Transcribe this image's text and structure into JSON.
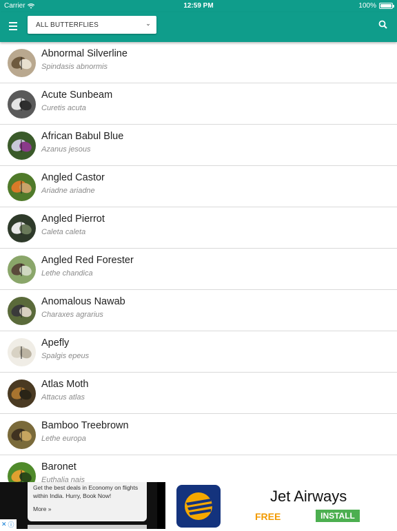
{
  "status_bar": {
    "carrier": "Carrier",
    "time": "12:59 PM",
    "battery": "100%",
    "battery_level": 1.0
  },
  "toolbar": {
    "menu_icon": "hamburger-menu-icon",
    "filter_value": "ALL BUTTERFLIES",
    "filter_icon": "chevron-down-icon",
    "search_icon": "search-icon",
    "color": "#0f9d8b"
  },
  "butterflies": [
    {
      "name": "Abnormal Silverline",
      "scientific": "Spindasis abnormis"
    },
    {
      "name": "Acute Sunbeam",
      "scientific": "Curetis acuta"
    },
    {
      "name": "African Babul Blue",
      "scientific": "Azanus jesous"
    },
    {
      "name": "Angled Castor",
      "scientific": "Ariadne ariadne"
    },
    {
      "name": "Angled Pierrot",
      "scientific": "Caleta caleta"
    },
    {
      "name": "Angled Red Forester",
      "scientific": "Lethe chandica"
    },
    {
      "name": "Anomalous Nawab",
      "scientific": "Charaxes agrarius"
    },
    {
      "name": "Apefly",
      "scientific": "Spalgis epeus"
    },
    {
      "name": "Atlas Moth",
      "scientific": "Attacus atlas"
    },
    {
      "name": "Bamboo Treebrown",
      "scientific": "Lethe europa"
    },
    {
      "name": "Baronet",
      "scientific": "Euthalia nais"
    }
  ],
  "ad": {
    "text": "Get the best deals in Economy on flights within India. Hurry, Book Now!",
    "more": "More »",
    "brand": "Jet Airways",
    "price": "FREE",
    "install": "INSTALL"
  }
}
